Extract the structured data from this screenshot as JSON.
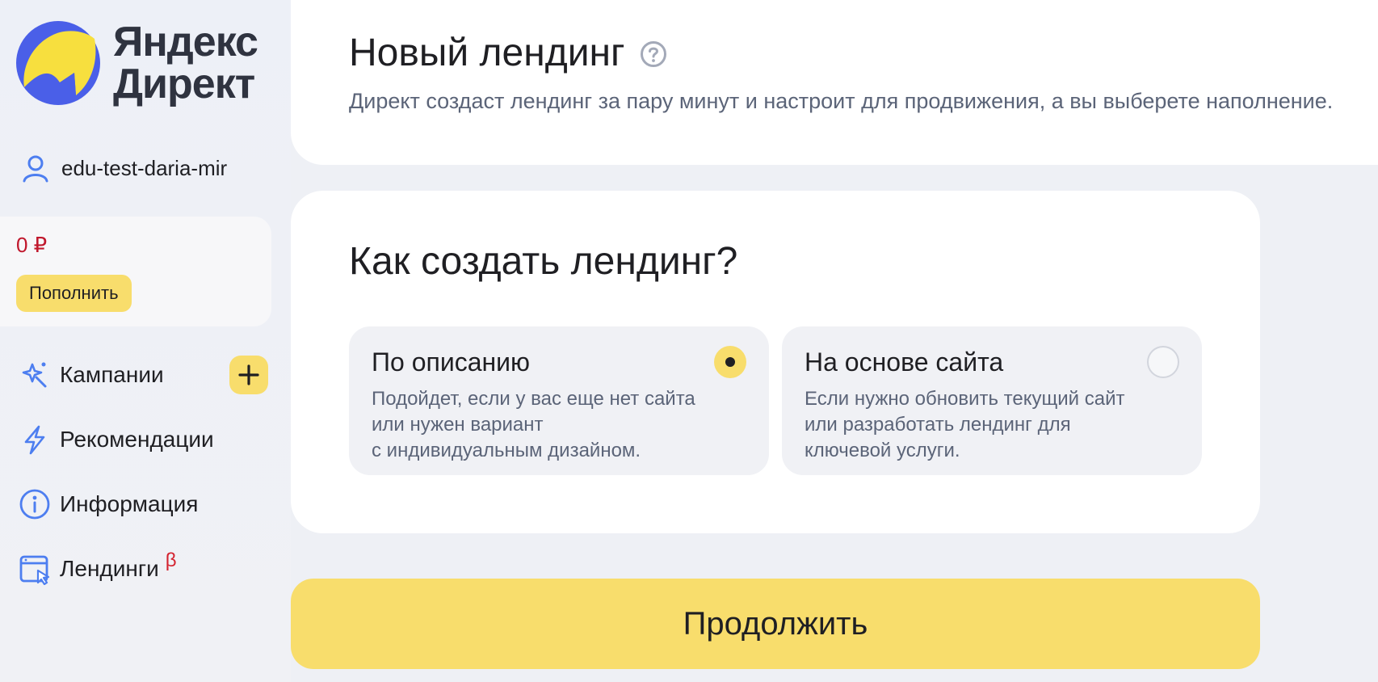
{
  "sidebar": {
    "logo": {
      "line1": "Яндекс",
      "line2": "Директ"
    },
    "user": {
      "name": "edu-test-daria-mir",
      "icon": "user-icon"
    },
    "balance": {
      "value": "0 ₽",
      "topup_label": "Пополнить"
    },
    "nav": [
      {
        "label": "Кампании",
        "icon": "sparkle-wand-icon"
      },
      {
        "label": "Рекомендации",
        "icon": "lightning-icon"
      },
      {
        "label": "Информация",
        "icon": "info-icon"
      },
      {
        "label": "Лендинги",
        "icon": "landing-page-icon",
        "badge": "β"
      }
    ]
  },
  "header": {
    "title": "Новый лендинг",
    "subtitle": "Директ создаст лендинг за пару минут и настроит для продвижения, а вы выберете наполнение."
  },
  "choice": {
    "title": "Как создать лендинг?",
    "options": [
      {
        "title": "По описанию",
        "desc": [
          "Подойдет, если у вас еще нет сайта",
          "или нужен вариант",
          "с индивидуальным дизайном."
        ],
        "selected": true
      },
      {
        "title": "На основе сайта",
        "desc": [
          "Если нужно обновить текущий сайт",
          "или разработать лендинг для",
          "ключевой услуги."
        ],
        "selected": false
      }
    ]
  },
  "actions": {
    "continue_label": "Продолжить"
  },
  "colors": {
    "accent": "#f8dd6c",
    "balance": "#c0172c",
    "beta": "#d4232f",
    "icon": "#4d7ef0",
    "logo_blue": "#4a5fe8",
    "logo_yellow": "#f7df3e"
  }
}
